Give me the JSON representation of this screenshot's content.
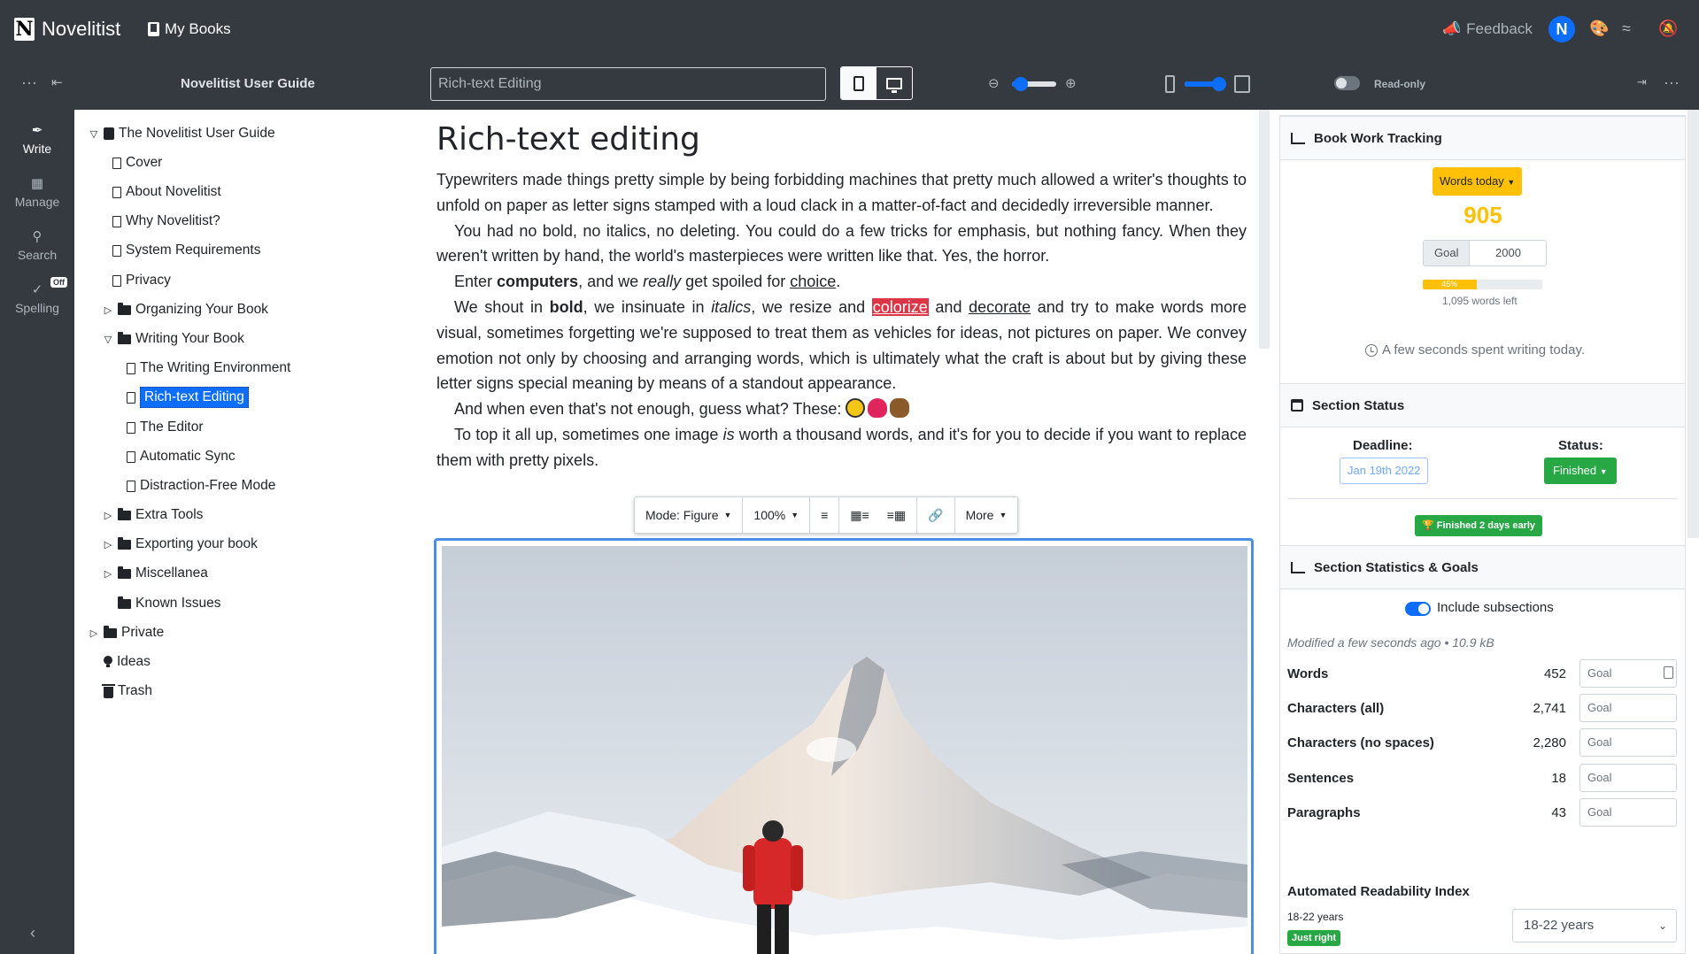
{
  "app": {
    "brand": "Novelitist",
    "my_books": "My Books",
    "feedback": "Feedback",
    "avatar_initial": "N"
  },
  "toolbar": {
    "book_title": "Novelitist User Guide",
    "section_title_value": "Rich-text Editing",
    "readonly_label": "Read-only",
    "zoom_level": 0.2,
    "width_level": 0.85
  },
  "nav": {
    "write": "Write",
    "manage": "Manage",
    "search": "Search",
    "spelling": "Spelling",
    "spelling_badge": "Off"
  },
  "tree": [
    {
      "label": "The Novelitist User Guide",
      "twisty": "open",
      "icon": "book"
    },
    {
      "label": "Cover",
      "twisty": "",
      "icon": "page"
    },
    {
      "label": "About Novelitist",
      "twisty": "",
      "icon": "page"
    },
    {
      "label": "Why Novelitist?",
      "twisty": "",
      "icon": "page"
    },
    {
      "label": "System Requirements",
      "twisty": "",
      "icon": "page"
    },
    {
      "label": "Privacy",
      "twisty": "",
      "icon": "page"
    },
    {
      "label": "Organizing Your Book",
      "twisty": "closed",
      "icon": "folder"
    },
    {
      "label": "Writing Your Book",
      "twisty": "open",
      "icon": "folder"
    },
    {
      "label": "The Writing Environment",
      "twisty": "",
      "icon": "page"
    },
    {
      "label": "Rich-text Editing",
      "twisty": "",
      "icon": "page",
      "selected": true
    },
    {
      "label": "The Editor",
      "twisty": "",
      "icon": "page"
    },
    {
      "label": "Automatic Sync",
      "twisty": "",
      "icon": "page"
    },
    {
      "label": "Distraction-Free Mode",
      "twisty": "",
      "icon": "page"
    },
    {
      "label": "Extra Tools",
      "twisty": "closed",
      "icon": "folder"
    },
    {
      "label": "Exporting your book",
      "twisty": "closed",
      "icon": "folder"
    },
    {
      "label": "Miscellanea",
      "twisty": "closed",
      "icon": "folder"
    },
    {
      "label": "Known Issues",
      "twisty": "",
      "icon": "folder"
    },
    {
      "label": "Private",
      "twisty": "closed",
      "icon": "folder"
    },
    {
      "label": "Ideas",
      "twisty": "",
      "icon": "bulb"
    },
    {
      "label": "Trash",
      "twisty": "",
      "icon": "trash"
    }
  ],
  "document": {
    "title": "Rich-text editing",
    "p1": "Typewriters made things pretty simple by being forbidding machines that pretty much allowed a writer's thoughts to unfold on paper as letter signs stamped with a loud clack in a matter-of-fact and decidedly irreversible manner.",
    "p2": "You had no bold, no italics, no deleting. You could do a few tricks for emphasis, but nothing fancy. When they weren't written by hand, the world's masterpieces were written like that. Yes, the horror.",
    "p3": {
      "a": "Enter ",
      "b": "computers",
      "c": ", and we ",
      "d": "really",
      "e": " get spoiled for ",
      "f": "choice",
      "g": "."
    },
    "p4": {
      "a": "We shout in ",
      "b": "bold",
      "c": ", we insinuate in ",
      "d": "italics",
      "e": ", we resize and ",
      "f": "colorize",
      "g": " and ",
      "h": "decorate",
      "i": " and try to make words more visual, sometimes forgetting we're supposed to treat them as vehicles for ideas, not pictures on paper. We convey emotion not only by choosing and arranging words, which is ultimately what the craft is about but by giving these letter signs special meaning by means of a standout appearance."
    },
    "p5": "And when even that's not enough, guess what? These: ",
    "p6": {
      "a": "To top it all up, sometimes one image ",
      "b": "is",
      "c": " worth a thousand words, and it's for you to decide if you want to replace them with pretty pixels."
    }
  },
  "image_toolbar": {
    "mode": "Mode: Figure",
    "zoom": "100%",
    "more": "More"
  },
  "tracking": {
    "header": "Book Work Tracking",
    "words_today_btn": "Words today",
    "words_today": "905",
    "goal_label": "Goal",
    "goal_value": "2000",
    "progress_pct": 45,
    "progress_label": "45%",
    "words_left": "1,095 words left",
    "time_spent": "A few seconds spent writing today."
  },
  "status": {
    "header": "Section Status",
    "deadline_label": "Deadline:",
    "deadline_value": "Jan 19th 2022",
    "status_label": "Status:",
    "status_value": "Finished",
    "badge": "Finished 2 days early"
  },
  "stats": {
    "header": "Section Statistics & Goals",
    "include_subsections": "Include subsections",
    "modified": "Modified a few seconds ago • 10.9 kB",
    "rows": [
      {
        "label": "Words",
        "value": "452",
        "goal_placeholder": "Goal"
      },
      {
        "label": "Characters (all)",
        "value": "2,741",
        "goal_placeholder": "Goal"
      },
      {
        "label": "Characters (no spaces)",
        "value": "2,280",
        "goal_placeholder": "Goal"
      },
      {
        "label": "Sentences",
        "value": "18",
        "goal_placeholder": "Goal"
      },
      {
        "label": "Paragraphs",
        "value": "43",
        "goal_placeholder": "Goal"
      }
    ],
    "ari_label": "Automated Readability Index",
    "ari_value": "18-22 years",
    "ari_badge": "Just right",
    "ari_select": "18-22 years"
  },
  "colors": {
    "dark_bar": "#343a40",
    "accent": "#0d6efd",
    "warning": "#ffc107",
    "success": "#28a745",
    "danger": "#dc3545"
  }
}
